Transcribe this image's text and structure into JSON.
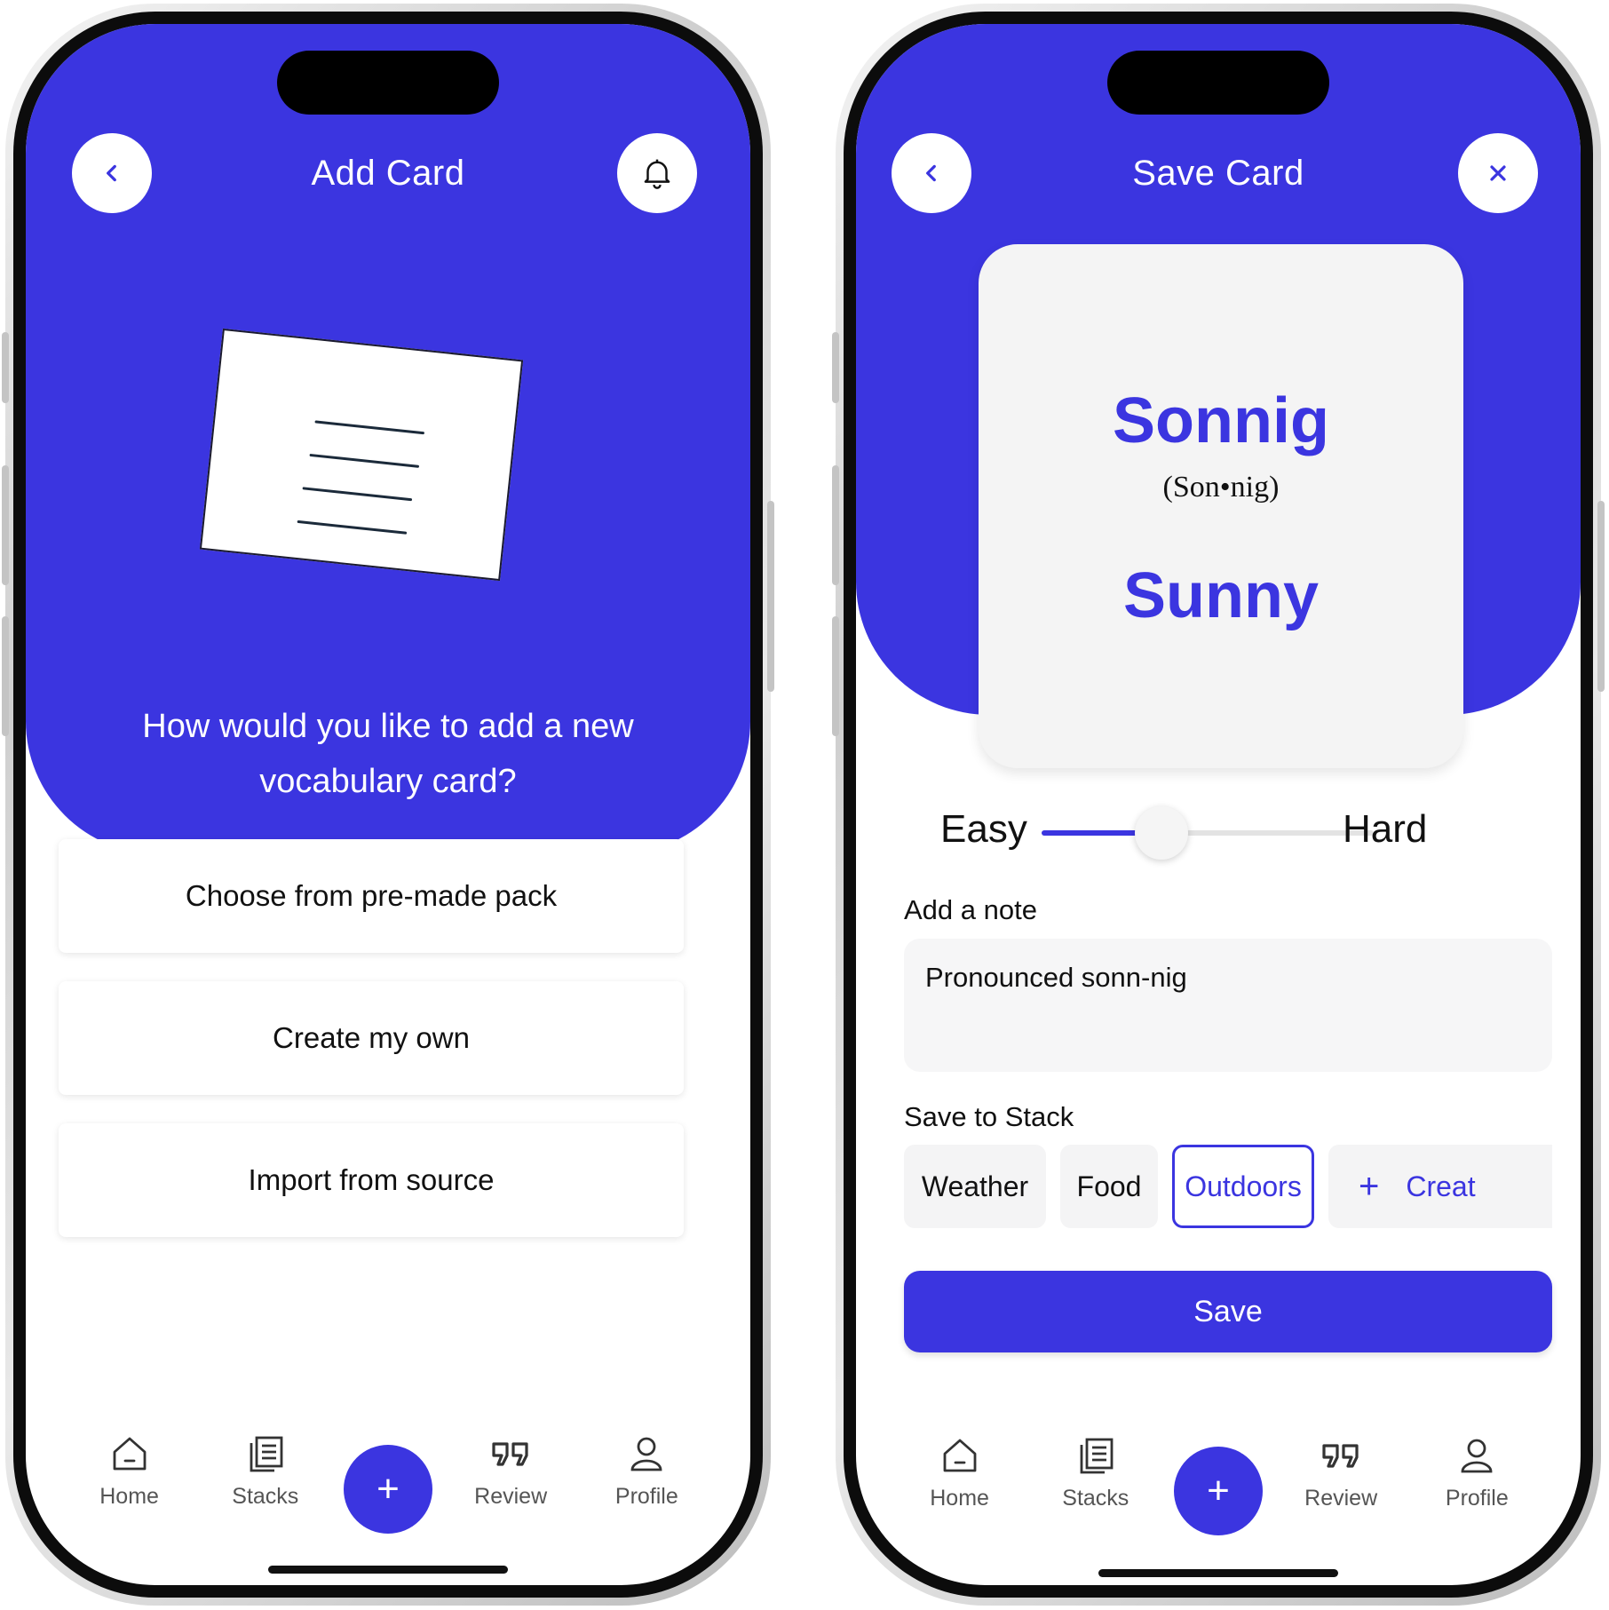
{
  "add_card_screen": {
    "title": "Add Card",
    "question": "How would you like to add a new vocabulary card?",
    "options": [
      {
        "label": "Choose from pre-made pack"
      },
      {
        "label": "Create my own"
      },
      {
        "label": "Import from source"
      }
    ]
  },
  "save_card_screen": {
    "title": "Save Card",
    "card": {
      "word": "Sonnig",
      "pronunciation": "(Son•nig)",
      "translation": "Sunny"
    },
    "difficulty": {
      "min_label": "Easy",
      "max_label": "Hard",
      "level": 0.36
    },
    "note": {
      "label": "Add a note",
      "value": "Pronounced sonn-nig"
    },
    "stack": {
      "label": "Save to Stack",
      "options": [
        "Weather",
        "Food",
        "Outdoors"
      ],
      "selected": "Outdoors",
      "create_label": "Creat"
    },
    "save_label": "Save"
  },
  "nav": {
    "home": "Home",
    "stacks": "Stacks",
    "add": "+",
    "review": "Review",
    "profile": "Profile"
  },
  "colors": {
    "primary": "#3b35e0",
    "card_bg": "#f4f4f4",
    "text": "#111111"
  },
  "icons": {
    "back": "chevron-left-icon",
    "bell": "bell-icon",
    "close": "close-icon",
    "home": "home-icon",
    "stacks": "stacks-icon",
    "review": "quote-icon",
    "profile": "user-icon"
  }
}
